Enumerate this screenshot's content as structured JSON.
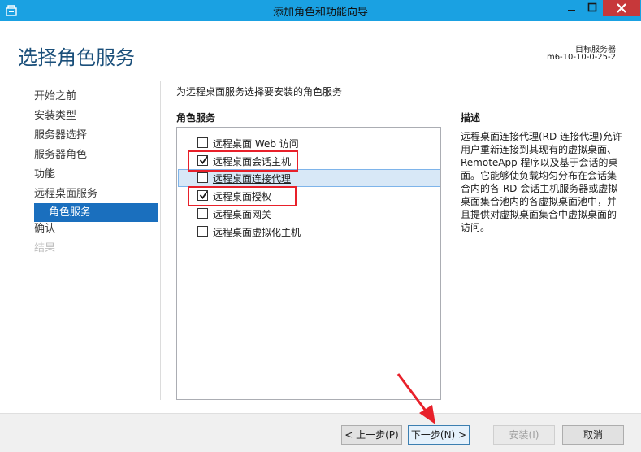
{
  "window": {
    "title": "添加角色和功能向导",
    "accent_color": "#1aa1e2"
  },
  "header": {
    "page_title": "选择角色服务",
    "server_label": "目标服务器",
    "server_name": "m6-10-10-0-25-2"
  },
  "nav": {
    "items": [
      {
        "label": "开始之前",
        "state": "normal"
      },
      {
        "label": "安装类型",
        "state": "normal"
      },
      {
        "label": "服务器选择",
        "state": "normal"
      },
      {
        "label": "服务器角色",
        "state": "normal"
      },
      {
        "label": "功能",
        "state": "normal"
      },
      {
        "label": "远程桌面服务",
        "state": "normal"
      },
      {
        "label": "角色服务",
        "state": "selected"
      },
      {
        "label": "确认",
        "state": "normal"
      },
      {
        "label": "结果",
        "state": "disabled"
      }
    ]
  },
  "main": {
    "intro": "为远程桌面服务选择要安装的角色服务",
    "roles_heading": "角色服务",
    "roles": [
      {
        "label": "远程桌面 Web 访问",
        "checked": false
      },
      {
        "label": "远程桌面会话主机",
        "checked": true
      },
      {
        "label": "远程桌面连接代理",
        "checked": false
      },
      {
        "label": "远程桌面授权",
        "checked": true
      },
      {
        "label": "远程桌面网关",
        "checked": false
      },
      {
        "label": "远程桌面虚拟化主机",
        "checked": false
      }
    ],
    "description_heading": "描述",
    "description": "远程桌面连接代理(RD 连接代理)允许用户重新连接到其现有的虚拟桌面、RemoteApp 程序以及基于会话的桌面。它能够使负载均匀分布在会话集合内的各 RD 会话主机服务器或虚拟桌面集合池内的各虚拟桌面池中，并且提供对虚拟桌面集合中虚拟桌面的访问。"
  },
  "footer": {
    "prev_label": "< 上一步(P)",
    "next_label": "下一步(N) >",
    "install_label": "安装(I)",
    "cancel_label": "取消"
  }
}
